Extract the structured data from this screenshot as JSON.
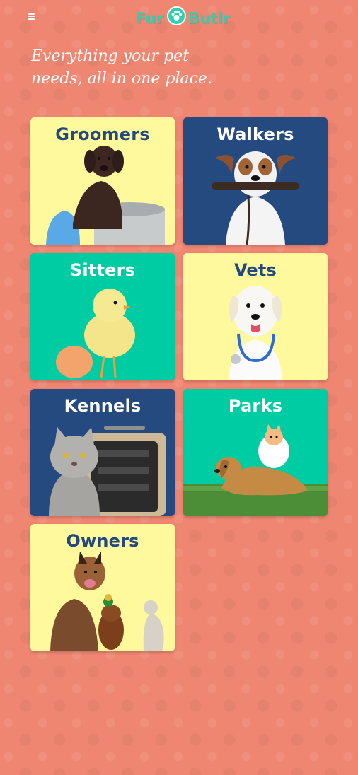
{
  "header": {
    "menu_icon": "hamburger-menu-icon",
    "logo": {
      "text_left": "Fur",
      "text_right": "Butlr",
      "color": "#2fd0b2"
    }
  },
  "tagline": {
    "line1": "Everything your pet",
    "line2": "needs, all in one place."
  },
  "categories": [
    {
      "label": "Groomers",
      "bg": "#fdf99c",
      "text_color": "#24497f",
      "image": "puppy-in-bucket-image"
    },
    {
      "label": "Walkers",
      "bg": "#254a80",
      "text_color": "#ffffff",
      "image": "dog-with-leash-image"
    },
    {
      "label": "Sitters",
      "bg": "#00cca3",
      "text_color": "#ffffff",
      "image": "chick-and-egg-image"
    },
    {
      "label": "Vets",
      "bg": "#fdf99c",
      "text_color": "#24497f",
      "image": "dog-with-stethoscope-image"
    },
    {
      "label": "Kennels",
      "bg": "#254a80",
      "text_color": "#ffffff",
      "image": "cat-and-pet-carrier-image"
    },
    {
      "label": "Parks",
      "bg": "#00cca3",
      "text_color": "#ffffff",
      "image": "dog-and-cat-on-grass-image"
    },
    {
      "label": "Owners",
      "bg": "#fdf99c",
      "text_color": "#24497f",
      "image": "group-of-pets-image"
    }
  ],
  "colors": {
    "page_background": "#ef8672",
    "accent_teal": "#00cca3",
    "navy": "#254a80",
    "pale_yellow": "#fdf99c"
  }
}
